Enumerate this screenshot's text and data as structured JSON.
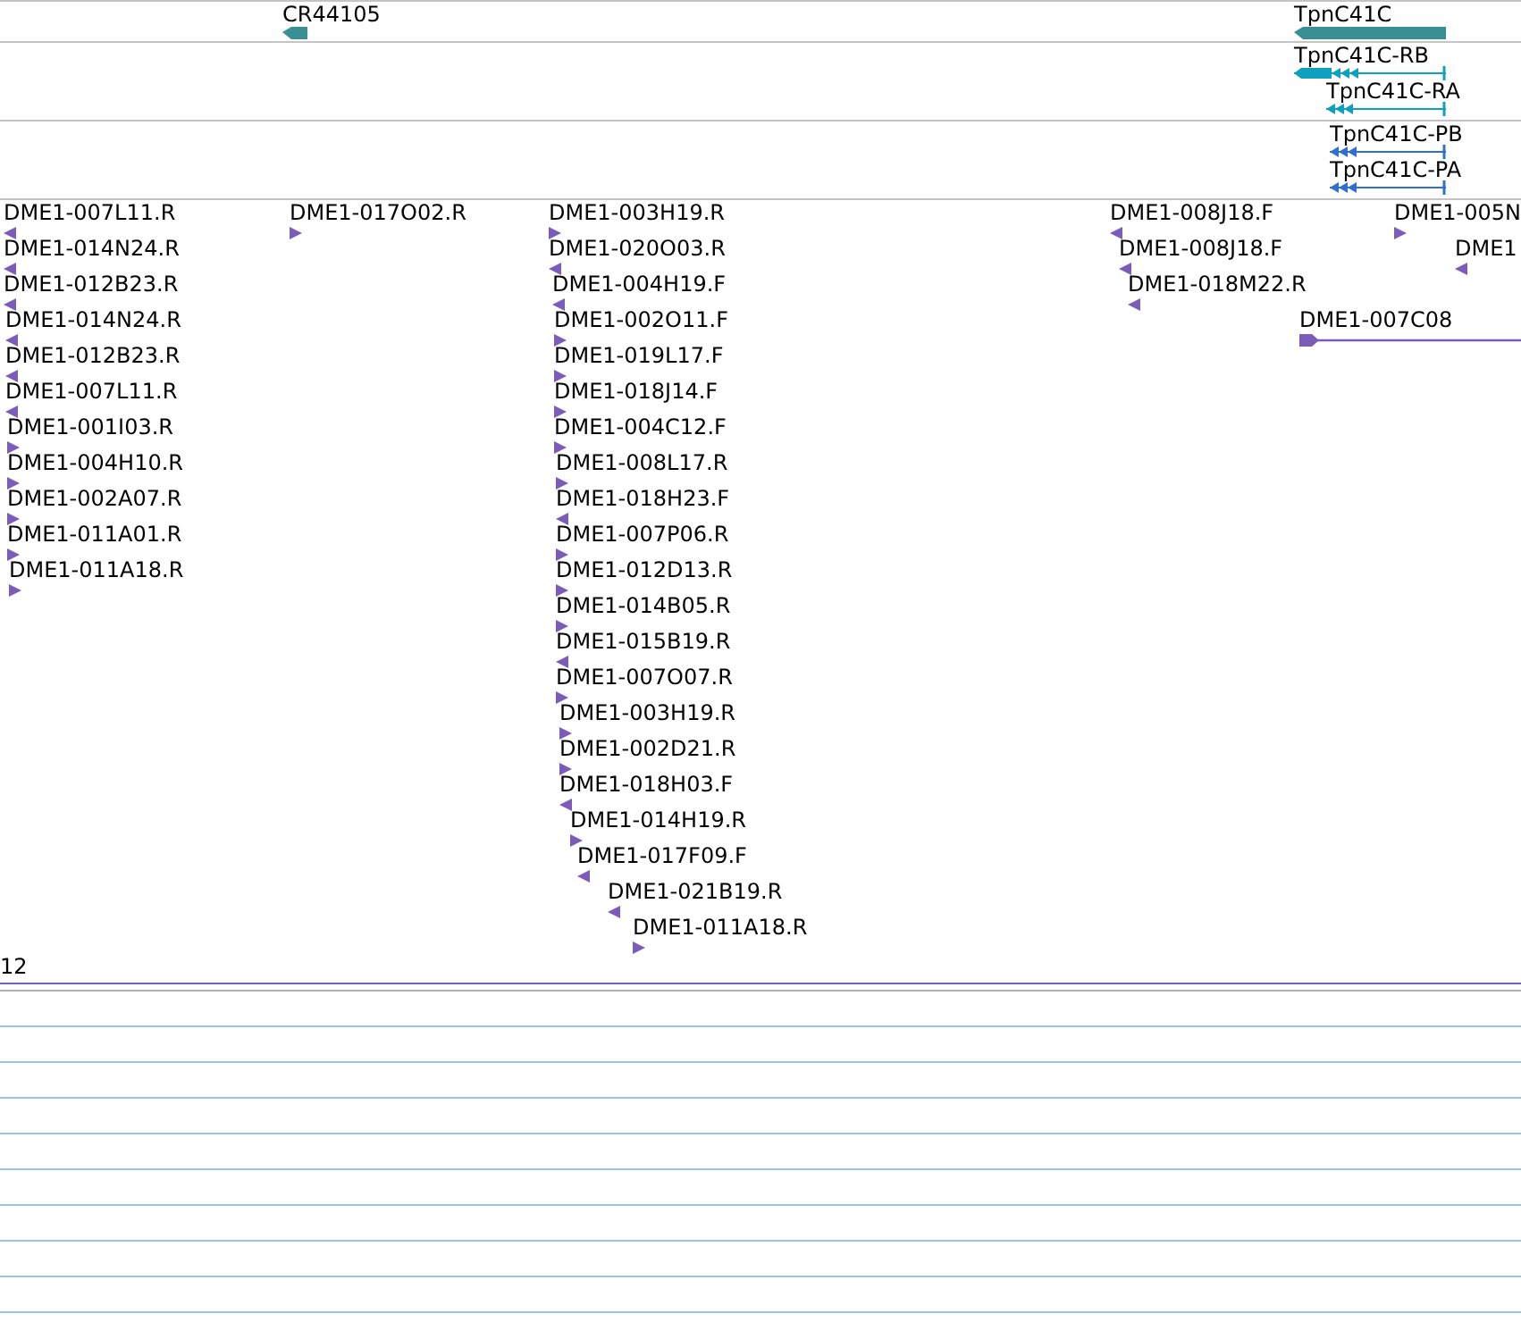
{
  "gene_track": {
    "features": [
      {
        "label": "CR44105",
        "reverse_strand": true
      },
      {
        "label": "TpnC41C",
        "reverse_strand": true
      }
    ]
  },
  "transcript_track": {
    "features": [
      {
        "label": "TpnC41C-RB",
        "reverse_strand": true,
        "kind": "utr"
      },
      {
        "label": "TpnC41C-RA",
        "reverse_strand": true,
        "kind": "plain"
      }
    ]
  },
  "protein_track": {
    "features": [
      {
        "label": "TpnC41C-PB",
        "reverse_strand": true
      },
      {
        "label": "TpnC41C-PA",
        "reverse_strand": true
      }
    ]
  },
  "clone_track": {
    "features": [
      {
        "label": "DME1-007L11.R",
        "reverse_strand": true,
        "kind": "point"
      },
      {
        "label": "DME1-014N24.R",
        "reverse_strand": true,
        "kind": "point"
      },
      {
        "label": "DME1-012B23.R",
        "reverse_strand": true,
        "kind": "point"
      },
      {
        "label": "DME1-014N24.R",
        "reverse_strand": true,
        "kind": "point"
      },
      {
        "label": "DME1-012B23.R",
        "reverse_strand": true,
        "kind": "point"
      },
      {
        "label": "DME1-007L11.R",
        "reverse_strand": true,
        "kind": "point"
      },
      {
        "label": "DME1-001I03.R",
        "reverse_strand": false,
        "kind": "point"
      },
      {
        "label": "DME1-004H10.R",
        "reverse_strand": false,
        "kind": "point"
      },
      {
        "label": "DME1-002A07.R",
        "reverse_strand": false,
        "kind": "point"
      },
      {
        "label": "DME1-011A01.R",
        "reverse_strand": false,
        "kind": "point"
      },
      {
        "label": "DME1-011A18.R",
        "reverse_strand": false,
        "kind": "point"
      },
      {
        "label": "DME1-017O02.R",
        "reverse_strand": false,
        "kind": "point"
      },
      {
        "label": "DME1-003H19.R",
        "reverse_strand": false,
        "kind": "point"
      },
      {
        "label": "DME1-020O03.R",
        "reverse_strand": true,
        "kind": "point"
      },
      {
        "label": "DME1-004H19.F",
        "reverse_strand": true,
        "kind": "point"
      },
      {
        "label": "DME1-002O11.F",
        "reverse_strand": false,
        "kind": "point"
      },
      {
        "label": "DME1-019L17.F",
        "reverse_strand": false,
        "kind": "point"
      },
      {
        "label": "DME1-018J14.F",
        "reverse_strand": false,
        "kind": "point"
      },
      {
        "label": "DME1-004C12.F",
        "reverse_strand": false,
        "kind": "point"
      },
      {
        "label": "DME1-008L17.R",
        "reverse_strand": false,
        "kind": "point"
      },
      {
        "label": "DME1-018H23.F",
        "reverse_strand": true,
        "kind": "point"
      },
      {
        "label": "DME1-007P06.R",
        "reverse_strand": false,
        "kind": "point"
      },
      {
        "label": "DME1-012D13.R",
        "reverse_strand": false,
        "kind": "point"
      },
      {
        "label": "DME1-014B05.R",
        "reverse_strand": false,
        "kind": "point"
      },
      {
        "label": "DME1-015B19.R",
        "reverse_strand": true,
        "kind": "point"
      },
      {
        "label": "DME1-007O07.R",
        "reverse_strand": false,
        "kind": "point"
      },
      {
        "label": "DME1-003H19.R",
        "reverse_strand": false,
        "kind": "point"
      },
      {
        "label": "DME1-002D21.R",
        "reverse_strand": false,
        "kind": "point"
      },
      {
        "label": "DME1-018H03.F",
        "reverse_strand": true,
        "kind": "point"
      },
      {
        "label": "DME1-014H19.R",
        "reverse_strand": false,
        "kind": "point"
      },
      {
        "label": "DME1-017F09.F",
        "reverse_strand": true,
        "kind": "point"
      },
      {
        "label": "DME1-021B19.R",
        "reverse_strand": true,
        "kind": "point"
      },
      {
        "label": "DME1-011A18.R",
        "reverse_strand": false,
        "kind": "point"
      },
      {
        "label": "DME1-008J18.F",
        "reverse_strand": true,
        "kind": "point"
      },
      {
        "label": "DME1-008J18.F",
        "reverse_strand": true,
        "kind": "point"
      },
      {
        "label": "DME1-018M22.R",
        "reverse_strand": true,
        "kind": "point"
      },
      {
        "label": "DME1-007C08",
        "reverse_strand": false,
        "kind": "span"
      },
      {
        "label": "DME1-005N",
        "reverse_strand": false,
        "kind": "point"
      },
      {
        "label": "DME1",
        "reverse_strand": true,
        "kind": "point"
      }
    ]
  },
  "track_footer": {
    "label": "12"
  }
}
